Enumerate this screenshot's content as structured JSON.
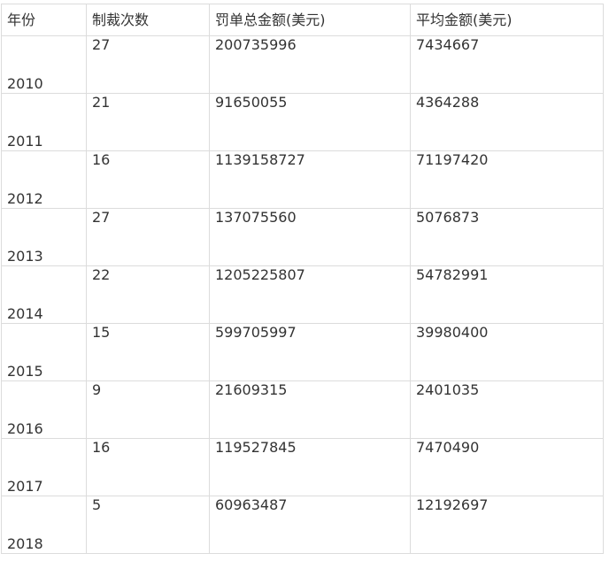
{
  "table": {
    "headers": [
      "年份",
      "制裁次数",
      "罚单总金额(美元)",
      "平均金额(美元)"
    ],
    "rows": [
      [
        "2010",
        "27",
        "200735996",
        "7434667"
      ],
      [
        "2011",
        "21",
        "91650055",
        "4364288"
      ],
      [
        "2012",
        "16",
        "1139158727",
        "71197420"
      ],
      [
        "2013",
        "27",
        "137075560",
        "5076873"
      ],
      [
        "2014",
        "22",
        "1205225807",
        "54782991"
      ],
      [
        "2015",
        "15",
        "599705997",
        "39980400"
      ],
      [
        "2016",
        "9",
        "21609315",
        "2401035"
      ],
      [
        "2017",
        "16",
        "119527845",
        "7470490"
      ],
      [
        "2018",
        "5",
        "60963487",
        "12192697"
      ]
    ]
  }
}
